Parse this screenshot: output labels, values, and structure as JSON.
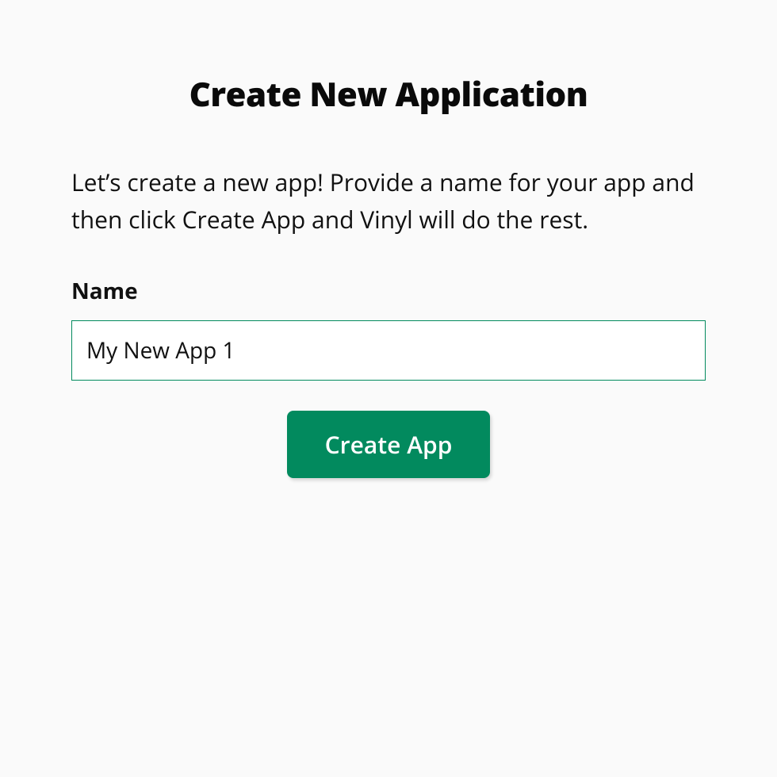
{
  "title": "Create New Application",
  "description": "Let’s create a new app! Provide a name for your app and then click Create App and Vinyl will do the rest.",
  "form": {
    "name_label": "Name",
    "name_value": "My New App 1",
    "submit_label": "Create App"
  }
}
